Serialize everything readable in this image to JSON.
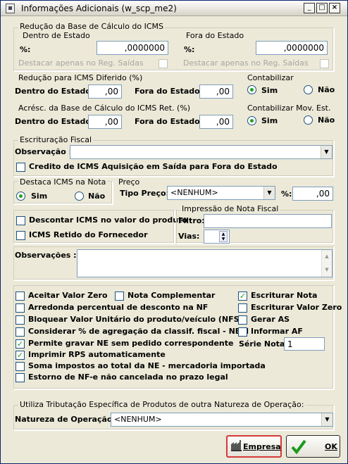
{
  "window": {
    "title": "Informações Adicionais (w_scp_me2)",
    "minimize": "_",
    "maximize": "□",
    "close": "×"
  },
  "reducao": {
    "title": "Redução da Base de Cálculo do ICMS",
    "dentro_title": "Dentro de Estado",
    "fora_title": "Fora do Estado",
    "pct_label": "%:",
    "dentro_value": ",0000000",
    "fora_value": ",0000000",
    "destacar_label": "Destacar apenas no Reg. Saídas"
  },
  "diferido": {
    "title": "Redução para ICMS Diferido (%)",
    "dentro_label": "Dentro do Estado:",
    "dentro_value": ",00",
    "fora_label": "Fora do Estado:",
    "fora_value": ",00"
  },
  "contabilizar": {
    "title": "Contabilizar",
    "sim": "Sim",
    "nao": "Não"
  },
  "acresc": {
    "title": "Acrésc. da Base de Cálculo do ICMS Ret. (%)",
    "dentro_label": "Dentro do Estado:",
    "dentro_value": ",00",
    "fora_label": "Fora do Estado:",
    "fora_value": ",00"
  },
  "contab_mov": {
    "title": "Contabilizar Mov. Est.",
    "sim": "Sim",
    "nao": "Não"
  },
  "escrituracao": {
    "title": "Escrituração Fiscal",
    "obs_label": "Observação :",
    "credito_label": "Credito de ICMS Aquisição em Saída para Fora do Estado"
  },
  "destaca": {
    "title": "Destaca ICMS na Nota",
    "sim": "Sim",
    "nao": "Não"
  },
  "preco": {
    "title": "Preço",
    "tipo_label": "Tipo Preço:",
    "tipo_value": "<NENHUM>",
    "pct_label": "%:",
    "pct_value": ",00"
  },
  "descontar_label": "Descontar ICMS no valor do produto",
  "retido_label": "ICMS Retido do Fornecedor",
  "impressao": {
    "title": "Impressão de Nota Fiscal",
    "filtro_label": "Filtro:",
    "filtro_value": "",
    "vias_label": "Vias:"
  },
  "observacoes_label": "Observações :",
  "checks": {
    "aceitar": "Aceitar Valor Zero",
    "nota_comp": "Nota Complementar",
    "escriturar_nota": "Escriturar Nota",
    "arredonda": "Arredonda percentual de desconto na NF",
    "escriturar_zero": "Escriturar Valor Zero",
    "bloquear": "Bloquear Valor Unitário do produto/veículo (NFS)",
    "gerar_as": "Gerar AS",
    "considerar": "Considerar % de agregação da classif. fiscal - NBM",
    "informar_af": "Informar AF",
    "permite": "Permite gravar NE sem pedido correspondente",
    "serie_label": "Série Nota:",
    "serie_value": "1",
    "imprimir": "Imprimir RPS automaticamente",
    "soma": "Soma impostos ao total da NE - mercadoria importada",
    "estorno": "Estorno de NF-e não cancelada no prazo legal"
  },
  "tributacao": {
    "title": "Utiliza Tributação Específica de Produtos de outra Natureza de Operação:",
    "natureza_label": "Natureza de Operação :",
    "natureza_value": "<NENHUM>"
  },
  "buttons": {
    "empresa": "Empresa",
    "ok": "OK"
  }
}
